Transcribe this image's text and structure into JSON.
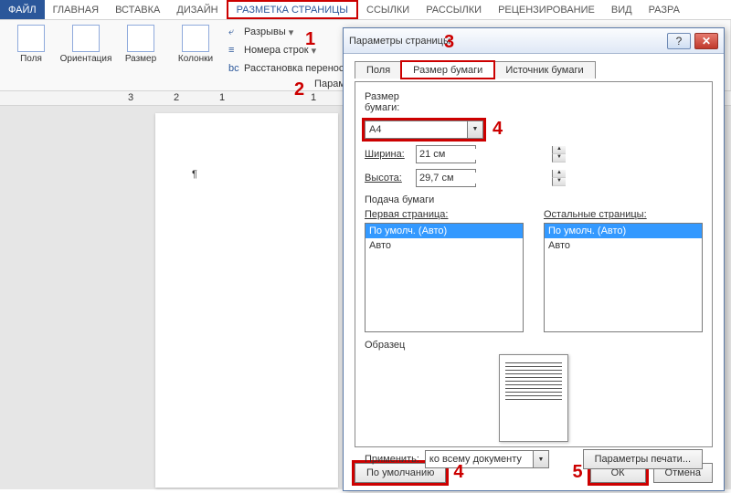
{
  "tabs": {
    "file": "ФАЙЛ",
    "home": "ГЛАВНАЯ",
    "insert": "ВСТАВКА",
    "design": "ДИЗАЙН",
    "layout": "РАЗМЕТКА СТРАНИЦЫ",
    "refs": "ССЫЛКИ",
    "mail": "РАССЫЛКИ",
    "review": "РЕЦЕНЗИРОВАНИЕ",
    "view": "ВИД",
    "extra": "РАЗРА"
  },
  "ribbon": {
    "margins": "Поля",
    "orientation": "Ориентация",
    "size": "Размер",
    "columns": "Колонки",
    "breaks": "Разрывы",
    "linenums": "Номера строк",
    "hyphen": "Расстановка переносов",
    "group": "Параметры страницы"
  },
  "ruler": [
    "3",
    "2",
    "1",
    "",
    "1"
  ],
  "doc": {
    "pilcrow": "¶"
  },
  "annot": {
    "n1": "1",
    "n2": "2",
    "n3": "3",
    "n4": "4",
    "n4b": "4",
    "n5": "5"
  },
  "dialog": {
    "title": "Параметры страницы",
    "help": "?",
    "close": "✕",
    "tabs": {
      "margins": "Поля",
      "paper": "Размер бумаги",
      "source": "Источник бумаги"
    },
    "size_label": "Размер бумаги:",
    "size_value": "A4",
    "width_label": "Ширина:",
    "width_value": "21 см",
    "height_label": "Высота:",
    "height_value": "29,7 см",
    "feed_label": "Подача бумаги",
    "first_page": "Первая страница:",
    "other_pages": "Остальные страницы:",
    "opt_default": "По умолч. (Авто)",
    "opt_auto": "Авто",
    "sample": "Образец",
    "apply_label": "Применить:",
    "apply_value": "ко всему документу",
    "print": "Параметры печати...",
    "default_btn": "По умолчанию",
    "ok": "ОК",
    "cancel": "Отмена"
  }
}
